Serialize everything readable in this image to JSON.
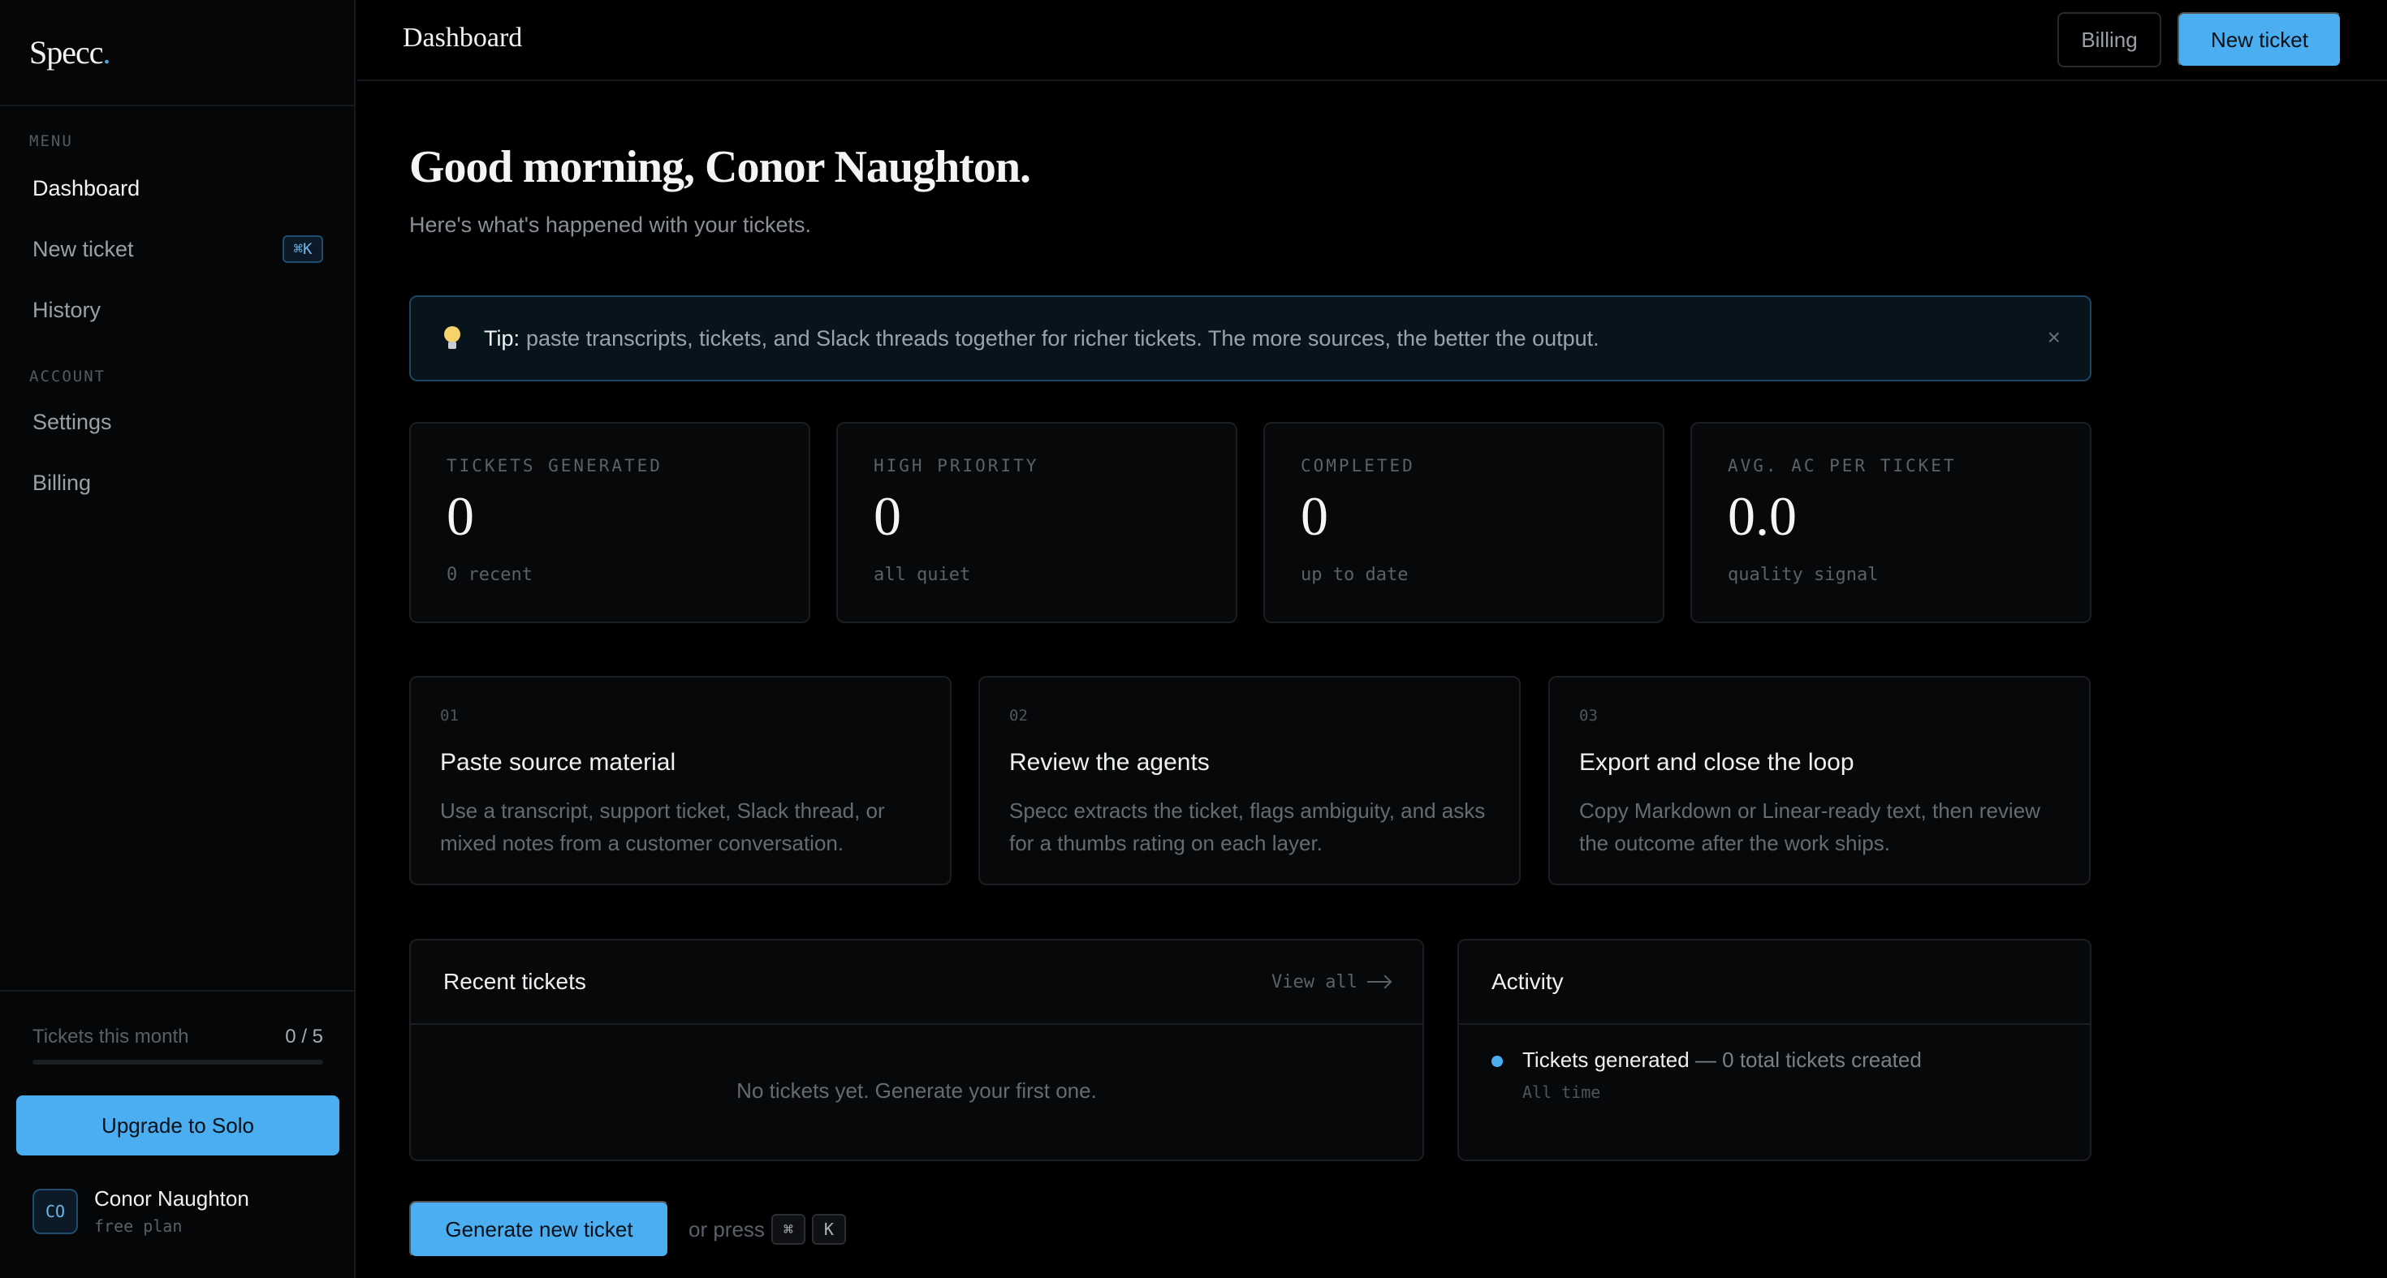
{
  "brand": {
    "name": "Specc",
    "dot": "."
  },
  "sidebar": {
    "menu_label": "MENU",
    "account_label": "ACCOUNT",
    "items": [
      {
        "label": "Dashboard"
      },
      {
        "label": "New ticket",
        "shortcut": "⌘K"
      },
      {
        "label": "History"
      }
    ],
    "account_items": [
      {
        "label": "Settings"
      },
      {
        "label": "Billing"
      }
    ],
    "usage": {
      "label": "Tickets this month",
      "count": "0 / 5",
      "progress": 0
    },
    "upgrade_label": "Upgrade to Solo",
    "user": {
      "initials": "CO",
      "name": "Conor Naughton",
      "plan": "free plan"
    }
  },
  "topbar": {
    "title": "Dashboard",
    "billing_label": "Billing",
    "new_ticket_label": "New ticket"
  },
  "main": {
    "greeting": "Good morning, Conor Naughton.",
    "subtitle": "Here's what's happened with your tickets.",
    "tip": {
      "strong": "Tip:",
      "text": "paste transcripts, tickets, and Slack threads together for richer tickets. The more sources, the better the output.",
      "close": "×"
    },
    "stats": [
      {
        "label": "TICKETS GENERATED",
        "value": "0",
        "sub": "0 recent"
      },
      {
        "label": "HIGH PRIORITY",
        "value": "0",
        "sub": "all quiet"
      },
      {
        "label": "COMPLETED",
        "value": "0",
        "sub": "up to date"
      },
      {
        "label": "AVG. AC PER TICKET",
        "value": "0.0",
        "sub": "quality signal"
      }
    ],
    "steps": [
      {
        "num": "01",
        "title": "Paste source material",
        "desc": "Use a transcript, support ticket, Slack thread, or mixed notes from a customer conversation."
      },
      {
        "num": "02",
        "title": "Review the agents",
        "desc": "Specc extracts the ticket, flags ambiguity, and asks for a thumbs rating on each layer."
      },
      {
        "num": "03",
        "title": "Export and close the loop",
        "desc": "Copy Markdown or Linear-ready text, then review the outcome after the work ships."
      }
    ],
    "recent": {
      "title": "Recent tickets",
      "view_all": "View all",
      "empty": "No tickets yet. Generate your first one."
    },
    "activity": {
      "title": "Activity",
      "items": [
        {
          "title": "Tickets generated",
          "desc": " — 0 total tickets created",
          "time": "All time"
        }
      ]
    },
    "generate_label": "Generate new ticket",
    "or_press": "or press",
    "keys": [
      "⌘",
      "K"
    ]
  },
  "colors": {
    "accent": "#4aaef0",
    "background": "#000000",
    "tip_border": "#1d4660"
  }
}
